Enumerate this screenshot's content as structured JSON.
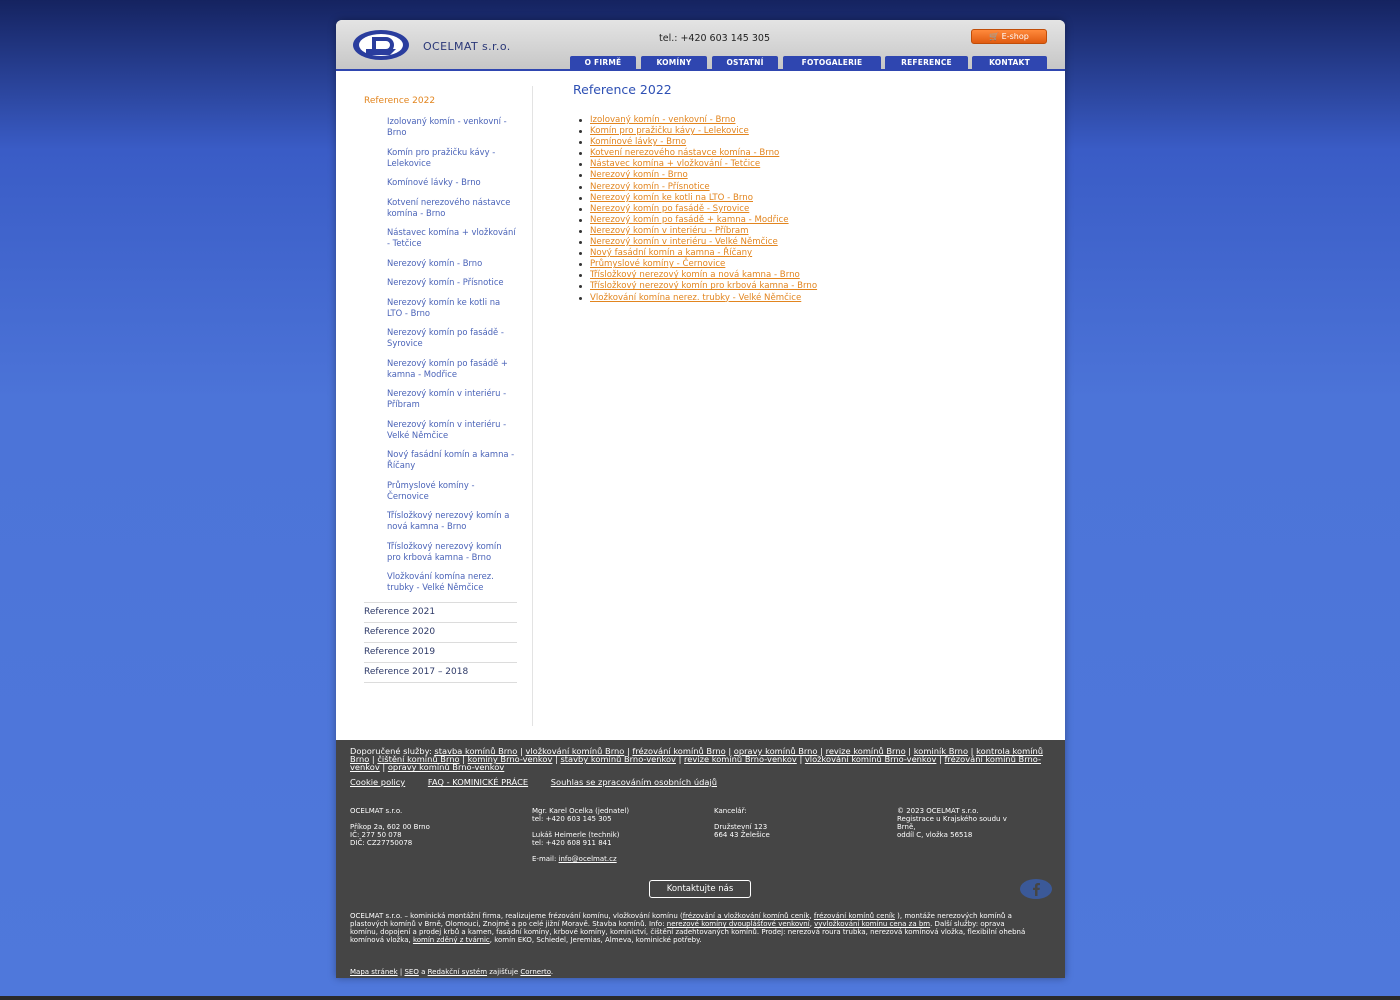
{
  "header": {
    "brand": "OCELMAT s.r.o.",
    "tel": "tel.: +420 603 145 305",
    "eshop": "E-shop",
    "logo_icon": "ocelmat-logo",
    "cart_icon": "cart-icon"
  },
  "nav": {
    "items": [
      "O FIRMĚ",
      "KOMÍNY",
      "OSTATNÍ",
      "FOTOGALERIE",
      "REFERENCE",
      "KONTAKT"
    ]
  },
  "sidebar": {
    "current": "Reference 2022",
    "sub_items": [
      "Izolovaný komín - venkovní - Brno",
      "Komín pro pražičku kávy - Lelekovice",
      "Komínové lávky - Brno",
      "Kotvení nerezového nástavce komína - Brno",
      "Nástavec komína + vložkování - Tetčice",
      "Nerezový komín - Brno",
      "Nerezový komín - Přísnotice",
      "Nerezový komín ke kotli na LTO - Brno",
      "Nerezový komín po fasádě - Syrovice",
      "Nerezový komín po fasádě + kamna - Modřice",
      "Nerezový komín v interiéru - Příbram",
      "Nerezový komín v interiéru - Velké Němčice",
      "Nový fasádní komín a kamna - Říčany",
      "Průmyslové komíny - Černovice",
      "Třísložkový nerezový komín a nová kamna - Brno",
      "Třísložkový nerezový komín pro krbová kamna - Brno",
      "Vložkování komína nerez. trubky - Velké Němčice"
    ],
    "years": [
      "Reference 2021",
      "Reference 2020",
      "Reference 2019",
      "Reference 2017 – 2018"
    ]
  },
  "content": {
    "title": "Reference 2022",
    "links": [
      "Izolovaný komín - venkovní - Brno",
      "Komín pro pražičku kávy - Lelekovice",
      "Komínové lávky - Brno",
      "Kotvení nerezového nástavce komína - Brno",
      "Nástavec komína + vložkování - Tetčice",
      "Nerezový komín - Brno",
      "Nerezový komín - Přísnotice",
      "Nerezový komín ke kotli na LTO - Brno",
      "Nerezový komín po fasádě - Syrovice",
      "Nerezový komín po fasádě + kamna - Modřice",
      "Nerezový komín v interiéru - Příbram",
      "Nerezový komín v interiéru - Velké Němčice",
      "Nový fasádní komín a kamna - Říčany",
      "Průmyslové komíny - Černovice",
      "Třísložkový nerezový komín a nová kamna - Brno",
      "Třísložkový nerezový komín pro krbová kamna - Brno",
      "Vložkování komína nerez. trubky - Velké Němčice"
    ]
  },
  "footer": {
    "services_label": "Doporučené služby:",
    "services": [
      "stavba komínů Brno",
      "vložkování komínů Brno",
      "frézování komínů Brno",
      "opravy komínů Brno",
      "revize komínů Brno",
      "kominík Brno",
      "kontrola komínů Brno",
      "čištění komínů Brno",
      "komíny Brno-venkov",
      "stavby komínů Brno-venkov",
      "revize komínů Brno-venkov",
      "vložkování komínů Brno-venkov",
      "frézování komínů Brno-venkov",
      "opravy komínů Brno-venkov"
    ],
    "links": [
      "Cookie policy",
      "FAQ - KOMINICKÉ PRÁCE",
      "Souhlas se zpracováním osobních údajů"
    ],
    "col1": {
      "name": "OCELMAT s.r.o.",
      "address": "Příkop 2a, 602 00 Brno",
      "ic": "IČ: 277 50 078",
      "dic": "DIČ: CZ27750078"
    },
    "col2": {
      "person1": "Mgr. Karel Ocelka (jednatel)",
      "tel1": "tel: +420 603 145 305",
      "person2": "Lukáš Heimerle (technik)",
      "tel2": "tel: +420 608 911 841",
      "email_label": "E-mail:",
      "email": "info@ocelmat.cz"
    },
    "col3": {
      "label": "Kancelář:",
      "street": "Družstevní 123",
      "city": "664 43 Želešice"
    },
    "col4": {
      "copy": "© 2023 OCELMAT s.r.o.",
      "reg1": "Registrace u Krajského soudu v",
      "reg2": "Brně,",
      "reg3": "oddíl C, vložka 56518"
    },
    "contact_button": "Kontaktujte nás",
    "facebook_icon": "facebook-icon",
    "about": {
      "t1": "OCELMAT s.r.o. – kominická montážní firma, realizujeme frézování komínu, vložkování komínu (",
      "l1": "frézování a vložkování komínů ceník",
      "t2": ", ",
      "l2": "frézování komínů ceník",
      "t3": " ), montáže nerezových komínů a plastových komínů v Brně, Olomouci, Znojmě a po celé jižní Moravě. Stavba komínů. Info: ",
      "l3": "nerezové komíny dvouplášťové venkovní",
      "t4": ", ",
      "l4": "vyvložkování komínu cena za bm",
      "t5": ". Další služby: oprava komínu, dopojení a prodej krbů a kamen, fasádní komíny, krbové komíny, kominictví, čištění zadehtovaných komínů. Prodej: nerezová roura trubka, nerezová komínová vložka, flexibilní ohebná komínová vložka, ",
      "l5": "komín zděný z tvárnic",
      "t6": ", komín EKO, Schiedel, Jeremias, Almeva, kominické potřeby."
    },
    "bottom": {
      "l1": "Mapa stránek",
      "sep": " | ",
      "l2": "SEO",
      "and": " a ",
      "l3": "Redakční systém",
      "t": " zajišťuje ",
      "l4": "Cornerto",
      "dot": "."
    }
  }
}
